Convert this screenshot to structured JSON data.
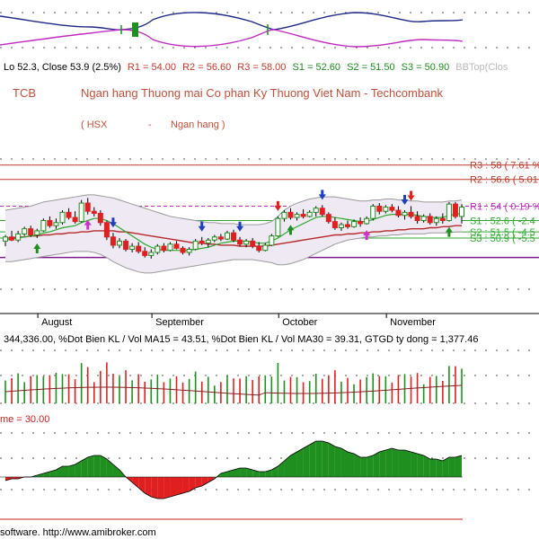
{
  "header": {
    "ohlc_text_prefix": "Lo 52.3, Close 53.9 (2.5%)",
    "pivots": [
      {
        "label": "R1 = 54.00",
        "color": "#c0392b"
      },
      {
        "label": "R2 = 56.60",
        "color": "#c0392b"
      },
      {
        "label": "R3 = 58.00",
        "color": "#c0392b"
      },
      {
        "label": "S1 = 52.60",
        "color": "#1e8a1e"
      },
      {
        "label": "S2 = 51.50",
        "color": "#1e8a1e"
      },
      {
        "label": "S3 = 50.90",
        "color": "#1e8a1e"
      },
      {
        "label": "BBTop(Clos",
        "color": "#bbbbbb"
      }
    ],
    "ticker": "TCB",
    "company": "Ngan hang Thuong mai Co phan Ky Thuong Viet Nam - Techcombank",
    "exchange": "( HSX",
    "dash": "-",
    "industry": "Ngan hang )"
  },
  "levels": {
    "r3": "R3 : 58 ( 7.61 %",
    "r2": "R2 : 56.6 ( 5.01",
    "r1": "R1 : 54 ( 0.19 %",
    "s1": "S1 : 52.6 ( -2.4",
    "s2": "S2 : 51.5 ( -4.5",
    "s3": "S3 : 50.9 ( -5.5"
  },
  "months": [
    "August",
    "September",
    "October",
    "November"
  ],
  "volume_header": "344,336.00, %Dot Bien KL / Vol MA15 = 43.51, %Dot Bien KL / Vol MA30 = 39.31, GTGD ty dong = 1,377.46",
  "osc_header": "me = 30.00",
  "footer": "software. http://www.amibroker.com",
  "colors": {
    "up": "#1f8f1f",
    "down": "#e02020",
    "bb": "#9a9a9a",
    "ma_red": "#b52a2a",
    "ma_green": "#2ea82e",
    "resist": "#c0392b",
    "support": "#7a1c8c"
  },
  "chart_data": {
    "type": "candlestick",
    "months": [
      "August",
      "September",
      "October",
      "November"
    ],
    "close_last": 53.9,
    "change_pct": 2.5,
    "low_last": 52.3,
    "pivot_levels": {
      "R1": 54.0,
      "R2": 56.6,
      "R3": 58.0,
      "S1": 52.6,
      "S2": 51.5,
      "S3": 50.9
    },
    "price_series": [
      {
        "o": 50.6,
        "h": 51.2,
        "l": 50.1,
        "c": 51.0
      },
      {
        "o": 51.0,
        "h": 51.6,
        "l": 50.6,
        "c": 50.7
      },
      {
        "o": 50.7,
        "h": 51.6,
        "l": 50.5,
        "c": 51.3
      },
      {
        "o": 51.3,
        "h": 52.0,
        "l": 51.1,
        "c": 51.8
      },
      {
        "o": 51.8,
        "h": 52.1,
        "l": 51.0,
        "c": 51.2
      },
      {
        "o": 51.2,
        "h": 51.8,
        "l": 50.9,
        "c": 51.6
      },
      {
        "o": 51.6,
        "h": 52.8,
        "l": 51.5,
        "c": 52.6
      },
      {
        "o": 52.6,
        "h": 53.0,
        "l": 51.9,
        "c": 52.1
      },
      {
        "o": 52.1,
        "h": 52.8,
        "l": 51.8,
        "c": 52.4
      },
      {
        "o": 52.4,
        "h": 53.6,
        "l": 52.2,
        "c": 53.4
      },
      {
        "o": 53.4,
        "h": 53.8,
        "l": 52.7,
        "c": 52.9
      },
      {
        "o": 52.9,
        "h": 53.5,
        "l": 52.3,
        "c": 52.5
      },
      {
        "o": 52.5,
        "h": 54.6,
        "l": 52.4,
        "c": 54.3
      },
      {
        "o": 54.3,
        "h": 54.8,
        "l": 53.2,
        "c": 53.5
      },
      {
        "o": 53.5,
        "h": 53.9,
        "l": 53.0,
        "c": 53.3
      },
      {
        "o": 53.3,
        "h": 53.6,
        "l": 52.1,
        "c": 52.4
      },
      {
        "o": 52.4,
        "h": 52.6,
        "l": 50.7,
        "c": 51.0
      },
      {
        "o": 51.0,
        "h": 51.4,
        "l": 49.9,
        "c": 50.2
      },
      {
        "o": 50.2,
        "h": 50.9,
        "l": 49.9,
        "c": 50.6
      },
      {
        "o": 50.6,
        "h": 50.8,
        "l": 49.6,
        "c": 49.8
      },
      {
        "o": 49.8,
        "h": 50.4,
        "l": 49.5,
        "c": 50.1
      },
      {
        "o": 50.1,
        "h": 50.5,
        "l": 49.4,
        "c": 49.6
      },
      {
        "o": 49.6,
        "h": 50.0,
        "l": 49.0,
        "c": 49.2
      },
      {
        "o": 49.2,
        "h": 49.8,
        "l": 48.9,
        "c": 49.5
      },
      {
        "o": 49.5,
        "h": 50.3,
        "l": 49.3,
        "c": 50.1
      },
      {
        "o": 50.1,
        "h": 50.4,
        "l": 49.5,
        "c": 49.7
      },
      {
        "o": 49.7,
        "h": 50.5,
        "l": 49.6,
        "c": 50.3
      },
      {
        "o": 50.3,
        "h": 50.6,
        "l": 49.8,
        "c": 49.9
      },
      {
        "o": 49.9,
        "h": 50.1,
        "l": 49.3,
        "c": 49.5
      },
      {
        "o": 49.5,
        "h": 50.0,
        "l": 49.2,
        "c": 49.8
      },
      {
        "o": 49.8,
        "h": 50.8,
        "l": 49.7,
        "c": 50.6
      },
      {
        "o": 50.6,
        "h": 51.0,
        "l": 50.2,
        "c": 50.4
      },
      {
        "o": 50.4,
        "h": 50.9,
        "l": 50.0,
        "c": 50.7
      },
      {
        "o": 50.7,
        "h": 51.2,
        "l": 50.5,
        "c": 51.0
      },
      {
        "o": 51.0,
        "h": 51.3,
        "l": 50.6,
        "c": 50.8
      },
      {
        "o": 50.8,
        "h": 51.6,
        "l": 50.7,
        "c": 51.4
      },
      {
        "o": 51.4,
        "h": 51.7,
        "l": 50.5,
        "c": 50.7
      },
      {
        "o": 50.7,
        "h": 51.0,
        "l": 50.1,
        "c": 50.3
      },
      {
        "o": 50.3,
        "h": 50.8,
        "l": 50.0,
        "c": 50.6
      },
      {
        "o": 50.6,
        "h": 50.9,
        "l": 49.9,
        "c": 50.1
      },
      {
        "o": 50.1,
        "h": 50.5,
        "l": 49.5,
        "c": 49.7
      },
      {
        "o": 49.7,
        "h": 50.4,
        "l": 49.6,
        "c": 50.2
      },
      {
        "o": 50.2,
        "h": 51.3,
        "l": 50.1,
        "c": 51.1
      },
      {
        "o": 51.1,
        "h": 53.0,
        "l": 51.0,
        "c": 52.8
      },
      {
        "o": 52.8,
        "h": 53.6,
        "l": 52.5,
        "c": 53.4
      },
      {
        "o": 53.4,
        "h": 53.8,
        "l": 52.7,
        "c": 52.9
      },
      {
        "o": 52.9,
        "h": 53.4,
        "l": 52.6,
        "c": 53.2
      },
      {
        "o": 53.2,
        "h": 53.7,
        "l": 52.8,
        "c": 53.0
      },
      {
        "o": 53.0,
        "h": 53.6,
        "l": 52.9,
        "c": 53.4
      },
      {
        "o": 53.4,
        "h": 54.0,
        "l": 53.0,
        "c": 53.8
      },
      {
        "o": 53.8,
        "h": 54.1,
        "l": 53.0,
        "c": 53.2
      },
      {
        "o": 53.2,
        "h": 53.4,
        "l": 52.3,
        "c": 52.5
      },
      {
        "o": 52.5,
        "h": 52.9,
        "l": 51.7,
        "c": 51.9
      },
      {
        "o": 51.9,
        "h": 52.4,
        "l": 51.6,
        "c": 52.2
      },
      {
        "o": 52.2,
        "h": 52.6,
        "l": 51.8,
        "c": 52.0
      },
      {
        "o": 52.0,
        "h": 52.7,
        "l": 51.9,
        "c": 52.5
      },
      {
        "o": 52.5,
        "h": 52.9,
        "l": 52.0,
        "c": 52.3
      },
      {
        "o": 52.3,
        "h": 53.0,
        "l": 52.2,
        "c": 52.8
      },
      {
        "o": 52.8,
        "h": 54.2,
        "l": 52.6,
        "c": 54.0
      },
      {
        "o": 54.0,
        "h": 54.3,
        "l": 53.2,
        "c": 53.5
      },
      {
        "o": 53.5,
        "h": 54.1,
        "l": 53.3,
        "c": 53.9
      },
      {
        "o": 53.9,
        "h": 54.2,
        "l": 53.4,
        "c": 53.6
      },
      {
        "o": 53.6,
        "h": 54.0,
        "l": 52.9,
        "c": 53.1
      },
      {
        "o": 53.1,
        "h": 53.6,
        "l": 52.7,
        "c": 53.4
      },
      {
        "o": 53.4,
        "h": 54.0,
        "l": 52.8,
        "c": 53.0
      },
      {
        "o": 53.0,
        "h": 53.5,
        "l": 52.3,
        "c": 52.6
      },
      {
        "o": 52.6,
        "h": 53.2,
        "l": 52.4,
        "c": 53.0
      },
      {
        "o": 53.0,
        "h": 53.3,
        "l": 52.2,
        "c": 52.4
      },
      {
        "o": 52.4,
        "h": 53.0,
        "l": 52.1,
        "c": 52.8
      },
      {
        "o": 52.8,
        "h": 53.3,
        "l": 52.3,
        "c": 52.6
      },
      {
        "o": 52.6,
        "h": 54.4,
        "l": 52.5,
        "c": 54.2
      },
      {
        "o": 54.2,
        "h": 54.4,
        "l": 52.8,
        "c": 53.0
      },
      {
        "o": 53.0,
        "h": 54.2,
        "l": 52.3,
        "c": 53.9
      }
    ],
    "bb_upper": [
      53.6,
      53.7,
      53.8,
      53.9,
      54.0,
      54.2,
      54.4,
      54.5,
      54.6,
      54.7,
      54.8,
      54.9,
      55.0,
      55.1,
      55.1,
      55.0,
      54.9,
      54.8,
      54.6,
      54.4,
      54.2,
      54.0,
      53.8,
      53.6,
      53.4,
      53.2,
      53.0,
      52.9,
      52.8,
      52.7,
      52.6,
      52.5,
      52.4,
      52.4,
      52.3,
      52.3,
      52.3,
      52.2,
      52.2,
      52.2,
      52.2,
      52.3,
      52.5,
      53.0,
      53.6,
      54.0,
      54.3,
      54.5,
      54.7,
      54.8,
      54.9,
      54.9,
      54.9,
      54.8,
      54.7,
      54.6,
      54.5,
      54.5,
      54.6,
      54.6,
      54.7,
      54.7,
      54.6,
      54.6,
      54.5,
      54.5,
      54.4,
      54.4,
      54.4,
      54.4,
      54.5,
      54.5,
      54.6
    ],
    "bb_lower": [
      48.6,
      48.6,
      48.7,
      48.8,
      48.9,
      49.0,
      49.1,
      49.2,
      49.3,
      49.4,
      49.5,
      49.6,
      49.6,
      49.6,
      49.5,
      49.3,
      49.0,
      48.6,
      48.3,
      48.0,
      47.8,
      47.6,
      47.5,
      47.5,
      47.6,
      47.7,
      47.8,
      47.9,
      48.0,
      48.1,
      48.2,
      48.3,
      48.4,
      48.5,
      48.6,
      48.7,
      48.8,
      48.8,
      48.8,
      48.8,
      48.7,
      48.6,
      48.5,
      48.3,
      48.3,
      48.4,
      48.6,
      48.8,
      49.1,
      49.4,
      49.7,
      50.0,
      50.3,
      50.5,
      50.7,
      50.8,
      50.9,
      51.0,
      51.0,
      51.1,
      51.1,
      51.2,
      51.2,
      51.3,
      51.3,
      51.3,
      51.3,
      51.4,
      51.4,
      51.4,
      51.4,
      51.5,
      51.5
    ],
    "ma_long": [
      50.9,
      50.9,
      51.0,
      51.0,
      51.1,
      51.1,
      51.2,
      51.2,
      51.3,
      51.3,
      51.4,
      51.4,
      51.5,
      51.5,
      51.6,
      51.6,
      51.6,
      51.6,
      51.5,
      51.5,
      51.4,
      51.3,
      51.2,
      51.1,
      51.0,
      50.9,
      50.8,
      50.7,
      50.6,
      50.5,
      50.4,
      50.4,
      50.3,
      50.3,
      50.2,
      50.2,
      50.2,
      50.1,
      50.1,
      50.1,
      50.1,
      50.1,
      50.2,
      50.3,
      50.4,
      50.5,
      50.6,
      50.7,
      50.8,
      50.9,
      51.0,
      51.1,
      51.2,
      51.2,
      51.3,
      51.3,
      51.4,
      51.4,
      51.5,
      51.5,
      51.6,
      51.6,
      51.7,
      51.7,
      51.8,
      51.8,
      51.8,
      51.9,
      51.9,
      52.0,
      52.0,
      52.1,
      52.1
    ],
    "ma_short": [
      50.7,
      50.8,
      50.9,
      51.0,
      51.1,
      51.2,
      51.4,
      51.5,
      51.7,
      51.9,
      52.0,
      52.1,
      52.4,
      52.6,
      52.8,
      52.8,
      52.6,
      52.3,
      51.9,
      51.5,
      51.1,
      50.7,
      50.3,
      50.0,
      49.8,
      49.7,
      49.7,
      49.7,
      49.7,
      49.7,
      49.8,
      49.9,
      50.0,
      50.2,
      50.4,
      50.5,
      50.6,
      50.6,
      50.6,
      50.5,
      50.4,
      50.4,
      50.6,
      50.9,
      51.3,
      51.7,
      52.0,
      52.3,
      52.6,
      52.9,
      53.0,
      53.0,
      52.9,
      52.8,
      52.7,
      52.6,
      52.5,
      52.5,
      52.7,
      52.9,
      53.1,
      53.2,
      53.2,
      53.2,
      53.2,
      53.1,
      53.0,
      52.9,
      52.9,
      52.9,
      53.1,
      53.2,
      53.3
    ]
  }
}
